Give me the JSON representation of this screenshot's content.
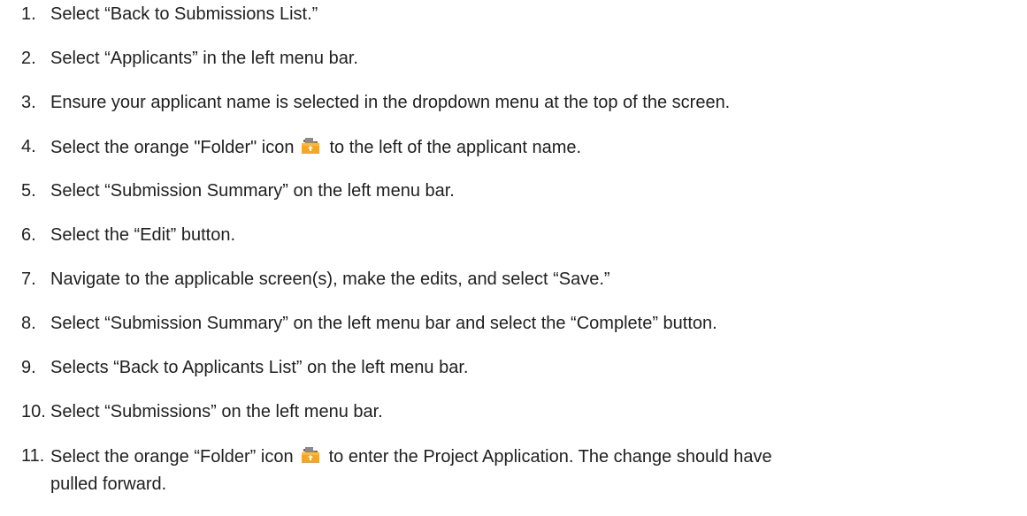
{
  "steps": [
    {
      "number": "1.",
      "text": "Select “Back to Submissions List.”"
    },
    {
      "number": "2.",
      "text": "Select “Applicants” in the left menu bar."
    },
    {
      "number": "3.",
      "text": "Ensure your applicant name is selected in the dropdown menu at the top of the screen."
    },
    {
      "number": "4.",
      "text_before": "Select the orange \"Folder\" icon",
      "text_after": "to the left of the applicant name.",
      "icon": "folder-icon"
    },
    {
      "number": "5.",
      "text": "Select “Submission Summary” on the left menu bar."
    },
    {
      "number": "6.",
      "text": "Select the “Edit” button."
    },
    {
      "number": "7.",
      "text": "Navigate to the applicable screen(s), make the edits, and select “Save.”"
    },
    {
      "number": "8.",
      "text": "Select “Submission Summary” on the left menu bar and select the “Complete” button."
    },
    {
      "number": "9.",
      "text": "Selects “Back to Applicants List” on the left menu bar."
    },
    {
      "number": "10.",
      "text": "Select “Submissions” on the left menu bar."
    },
    {
      "number": "11.",
      "text_before": "Select the orange “Folder” icon",
      "text_after": "to enter the Project Application. The change should have",
      "text_line2": "pulled forward.",
      "icon": "folder-icon"
    }
  ],
  "colors": {
    "text": "#1f1f1f",
    "folder_orange": "#f5a623",
    "folder_gray": "#6b6b6b"
  }
}
